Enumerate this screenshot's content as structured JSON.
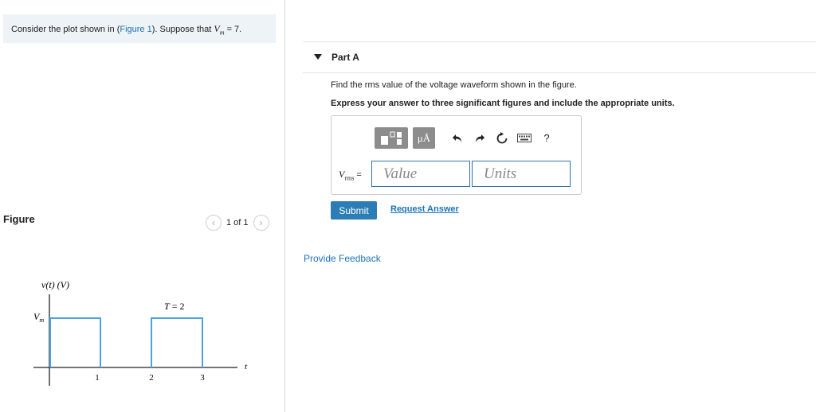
{
  "intro": {
    "prefix": "Consider the plot shown in (",
    "figure_link": "Figure 1",
    "middle": "). Suppose that ",
    "var": "V",
    "var_sub": "m",
    "suffix": " = 7."
  },
  "figure": {
    "heading": "Figure",
    "pager_text": "1 of 1",
    "plot": {
      "y_label": "v(t) (V)",
      "vm_label": "V",
      "vm_sub": "m",
      "period_label": "T = 2",
      "t_label": "t",
      "x_ticks": [
        "1",
        "2",
        "3"
      ],
      "pulses": [
        [
          0,
          1
        ],
        [
          2,
          3
        ]
      ],
      "high_level": "Vm",
      "line_color": "#4aa3e0"
    }
  },
  "part": {
    "title": "Part A",
    "question": "Find the rms value of the voltage waveform shown in the figure.",
    "instruction": "Express your answer to three significant figures and include the appropriate units."
  },
  "answer": {
    "label_var": "V",
    "label_sub": "rms",
    "label_eq": " =",
    "value_placeholder": "Value",
    "units_placeholder": "Units",
    "toolbar": {
      "units_button": "μÅ",
      "help": "?"
    }
  },
  "actions": {
    "submit": "Submit",
    "request_answer": "Request Answer",
    "feedback": "Provide Feedback"
  }
}
